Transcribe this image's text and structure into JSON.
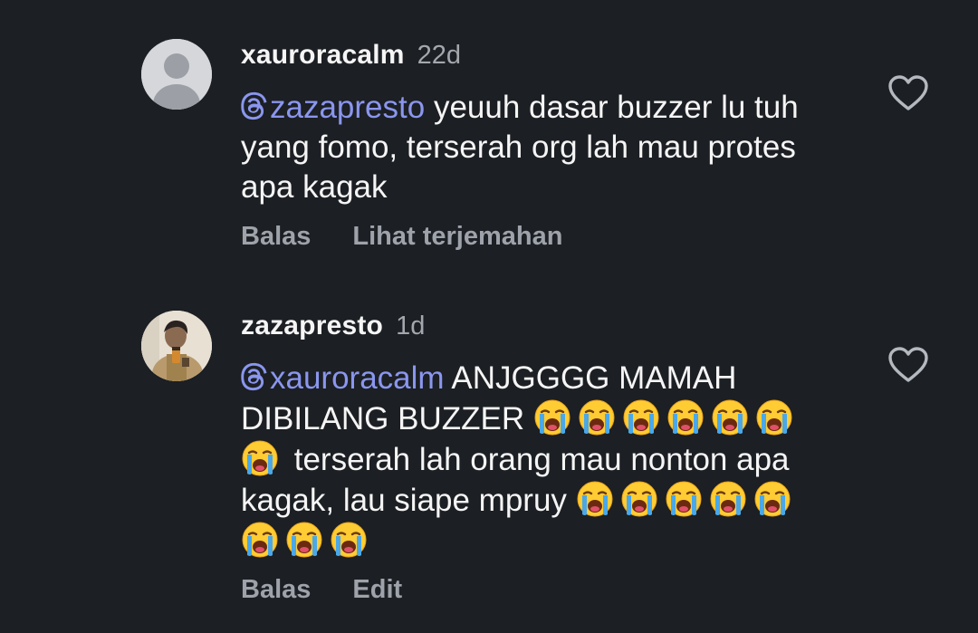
{
  "comments": [
    {
      "username": "xauroracalm",
      "time": "22d",
      "mention": "zazapresto",
      "text": " yeuuh dasar buzzer lu tuh yang fomo, terserah org lah mau protes apa kagak",
      "actions": [
        "Balas",
        "Lihat terjemahan"
      ],
      "avatar_icon": "default-user-icon",
      "like_icon": "heart-outline-icon"
    },
    {
      "username": "zazapresto",
      "time": "1d",
      "mention": "xauroracalm",
      "text_part1": " ANJGGGG MAMAH DIBILANG BUZZER ",
      "text_part2": " terserah lah orang mau nonton apa kagak, lau siape mpruy ",
      "actions": [
        "Balas",
        "Edit"
      ],
      "avatar_icon": "profile-photo",
      "like_icon": "heart-outline-icon",
      "emoji_name": "loudly-crying-face-emoji",
      "emoji_group1_count": 7,
      "emoji_group2_count": 8
    }
  ],
  "colors": {
    "background": "#1c1f23",
    "mention": "#8a96ee",
    "secondary_text": "#a3a7ae",
    "primary_text": "#f5f5f5"
  }
}
